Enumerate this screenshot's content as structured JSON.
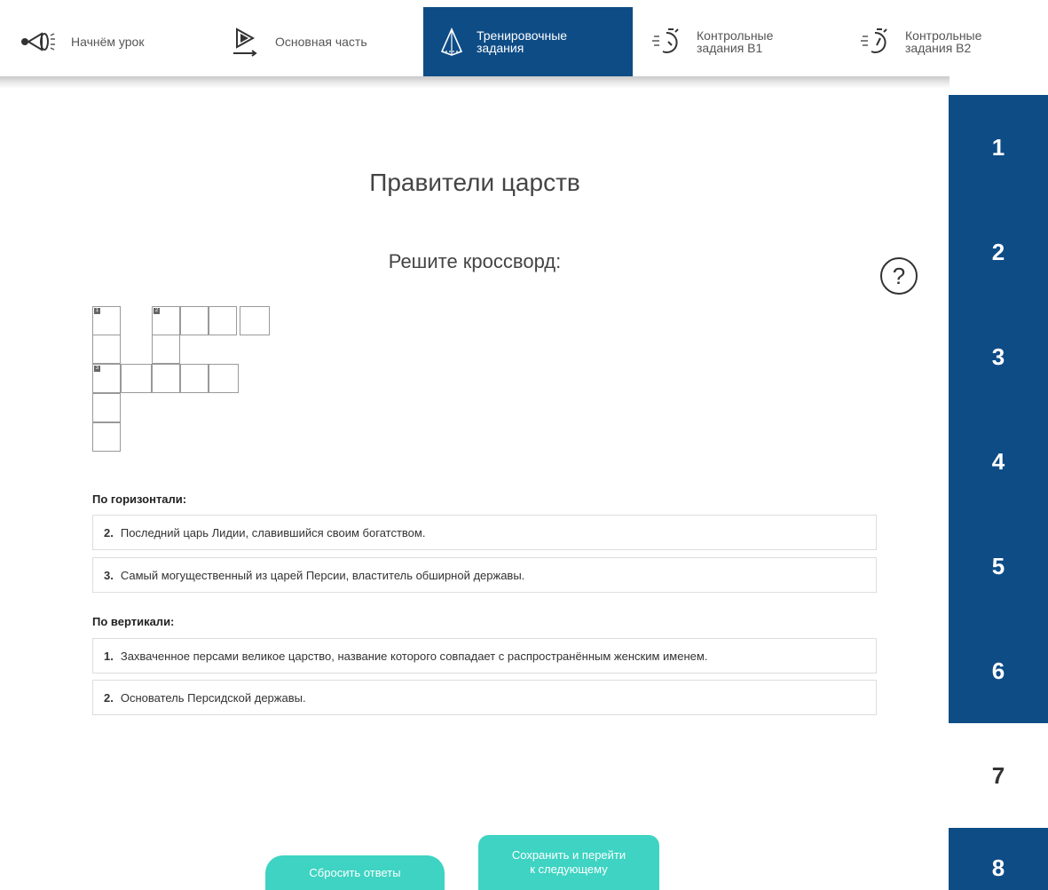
{
  "nav": {
    "items": [
      {
        "label": "Начнём урок",
        "icon": "flashlight-icon"
      },
      {
        "label": "Основная часть",
        "icon": "play-icon"
      },
      {
        "label": "Тренировочные\nзадания",
        "icon": "pyramid-icon"
      },
      {
        "label": "Контрольные\nзадания В1",
        "icon": "stopwatch-icon"
      },
      {
        "label": "Контрольные\nзадания В2",
        "icon": "stopwatch-icon"
      }
    ],
    "active_index": 2
  },
  "sidebar": {
    "numbers": [
      "1",
      "2",
      "3",
      "4",
      "5",
      "6",
      "7",
      "8"
    ],
    "current": "7"
  },
  "page": {
    "title": "Правители царств",
    "subtitle": "Решите кроссворд:",
    "help_symbol": "?"
  },
  "crossword": {
    "markers": [
      "1",
      "2",
      "3"
    ]
  },
  "clues": {
    "horizontal_header": "По горизонтали:",
    "horizontal": [
      {
        "num": "2.",
        "text": "Последний царь Лидии, славившийся своим богатством."
      },
      {
        "num": "3.",
        "text": "Самый могущественный из царей Персии, властитель обширной державы."
      }
    ],
    "vertical_header": "По вертикали:",
    "vertical": [
      {
        "num": "1.",
        "text": "Захваченное персами великое царство, название которого совпадает с распространённым женским именем."
      },
      {
        "num": "2.",
        "text": "Основатель Персидской державы."
      }
    ]
  },
  "buttons": {
    "reset": "Сбросить ответы",
    "save_next": "Сохранить и перейти\nк следующему"
  },
  "colors": {
    "primary": "#0e4c86",
    "accent": "#3ed3c2"
  }
}
